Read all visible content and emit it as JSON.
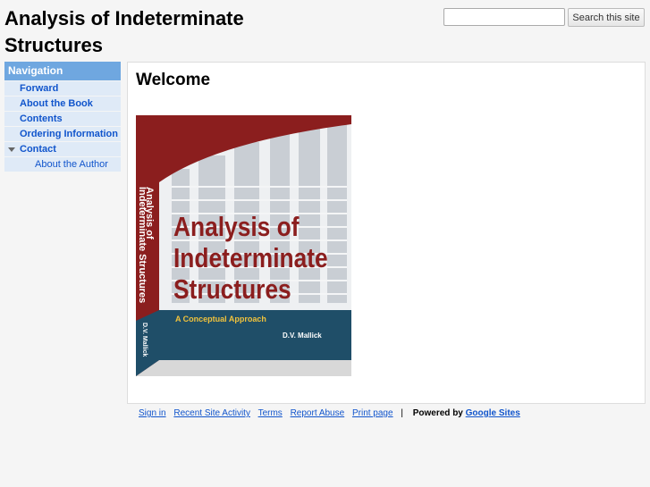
{
  "site": {
    "title": "Analysis of Indeterminate Structures"
  },
  "search": {
    "placeholder": "",
    "button_label": "Search this site"
  },
  "navigation": {
    "header": "Navigation",
    "items": [
      {
        "label": "Forward"
      },
      {
        "label": "About the Book"
      },
      {
        "label": "Contents"
      },
      {
        "label": "Ordering Information"
      },
      {
        "label": "Contact"
      },
      {
        "label": "About the Author"
      }
    ]
  },
  "main": {
    "title": "Welcome"
  },
  "book_cover": {
    "title_line1": "Analysis of",
    "title_line2": "Indeterminate",
    "title_line3": "Structures",
    "subtitle": "A Conceptual Approach",
    "author": "D.V. Mallick",
    "spine_title1": "Analysis of",
    "spine_title2": "Indeterminate Structures",
    "spine_author": "D.V. Mallick",
    "colors": {
      "maroon": "#8b1e1e",
      "teal": "#1f4e68",
      "title_red": "#8b1e1e",
      "subtitle_yellow": "#f0c23c"
    }
  },
  "footer": {
    "links": [
      "Sign in",
      "Recent Site Activity",
      "Terms",
      "Report Abuse",
      "Print page"
    ],
    "separator": "|",
    "powered_by": "Powered by",
    "google_sites": "Google Sites"
  }
}
